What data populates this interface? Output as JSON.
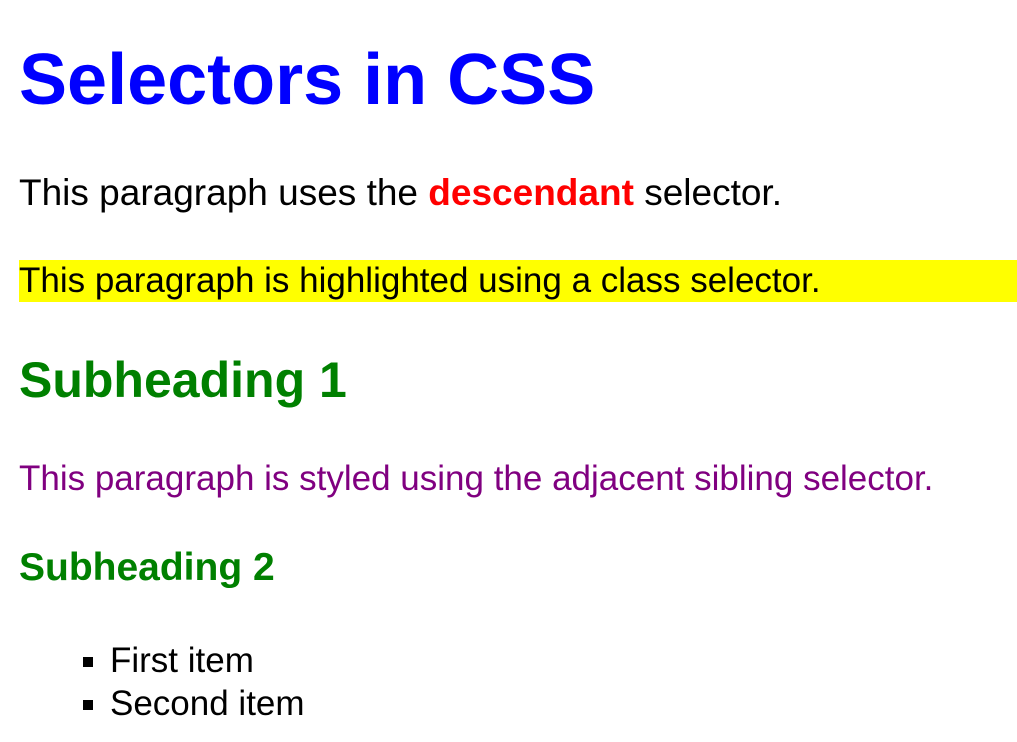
{
  "page": {
    "heading": "Selectors in CSS",
    "descendant_paragraph": {
      "before": "This paragraph uses the ",
      "emphasis": "descendant",
      "after": " selector."
    },
    "highlighted_paragraph": "This paragraph is highlighted using a class selector.",
    "subheading_1": "Subheading 1",
    "adjacent_paragraph": "This paragraph is styled using the adjacent sibling selector.",
    "subheading_2": "Subheading 2",
    "list_items": [
      "First item",
      "Second item"
    ]
  },
  "colors": {
    "heading": "#0000ff",
    "emphasis": "#ff0000",
    "highlight_background": "#ffff00",
    "subheading": "#008000",
    "adjacent_paragraph": "#800080",
    "text": "#000000"
  }
}
